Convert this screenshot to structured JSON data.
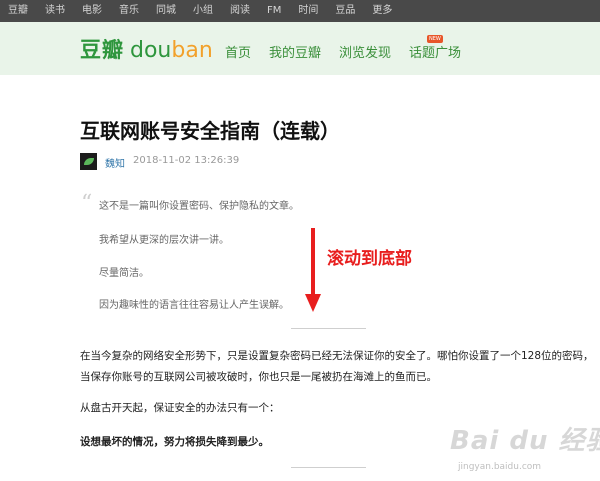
{
  "topbar": {
    "items": [
      "豆瓣",
      "读书",
      "电影",
      "音乐",
      "同城",
      "小组",
      "阅读",
      "FM",
      "时间",
      "豆品",
      "更多"
    ]
  },
  "header": {
    "logo_cn": "豆瓣",
    "logo_en_1": "dou",
    "logo_en_2": "ban",
    "nav": [
      "首页",
      "我的豆瓣",
      "浏览发现",
      "话题广场"
    ],
    "badge": "NEW"
  },
  "article": {
    "title": "互联网账号安全指南（连载）",
    "author": "魏知",
    "date": "2018-11-02 13:26:39",
    "quote_mark": "“",
    "quote_lines": [
      "这不是一篇叫你设置密码、保护隐私的文章。",
      "我希望从更深的层次讲一讲。",
      "尽量简洁。",
      "因为趣味性的语言往往容易让人产生误解。"
    ],
    "paragraphs": [
      "在当今复杂的网络安全形势下，只是设置复杂密码已经无法保证你的安全了。哪怕你设置了一个128位的密码，当保存你账号的互联网公司被攻破时，你也只是一尾被扔在海滩上的鱼而已。",
      "从盘古开天起，保证安全的办法只有一个：",
      "设想最坏的情况，努力将损失降到最少。"
    ]
  },
  "annotation": {
    "text": "滚动到底部",
    "color": "#e81e1e"
  },
  "watermark": {
    "big": "Bai du 经验",
    "small": "jingyan.baidu.com"
  },
  "colors": {
    "topbar_bg": "#494949",
    "header_bg": "#e9f4e9",
    "brand_green": "#2e963d",
    "link_blue": "#3377aa"
  }
}
